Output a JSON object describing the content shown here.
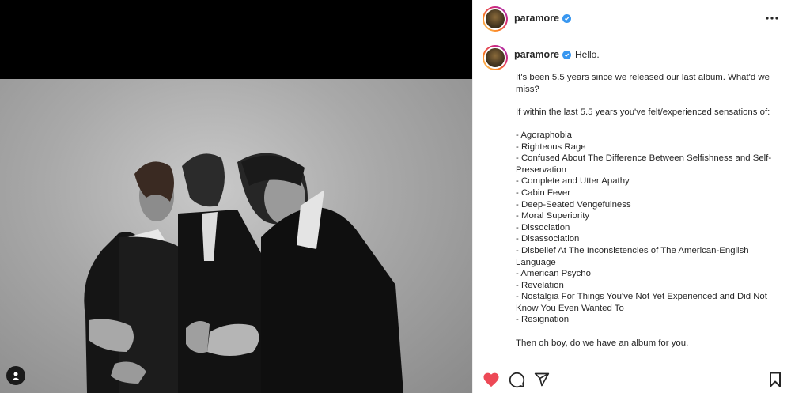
{
  "post": {
    "username": "paramore",
    "caption_opening": "Hello.",
    "caption_body": "It's been 5.5 years since we released our last album. What'd we miss?\n\nIf within the last 5.5 years you've felt/experienced sensations of:\n\n- Agoraphobia\n- Righteous Rage\n- Confused About The Difference Between Selfishness and Self-Preservation\n- Complete and Utter Apathy\n- Cabin Fever\n- Deep-Seated Vengefulness\n- Moral Superiority\n- Dissociation\n- Disassociation\n- Disbelief At The Inconsistencies of The American-English Language\n- American Psycho\n- Revelation\n- Nostalgia For Things You've Not Yet Experienced and Did Not Know You Even Wanted To\n- Resignation\n\nThen oh boy, do we have an album for you.",
    "liked": true
  },
  "icons": {
    "verified": "verified-badge-icon",
    "more": "more-options-icon",
    "like": "heart-icon",
    "comment": "comment-icon",
    "share": "share-icon",
    "save": "bookmark-icon",
    "user_tag": "user-tag-icon"
  },
  "colors": {
    "like": "#ed4956",
    "verified": "#3897f0",
    "text": "#262626"
  }
}
